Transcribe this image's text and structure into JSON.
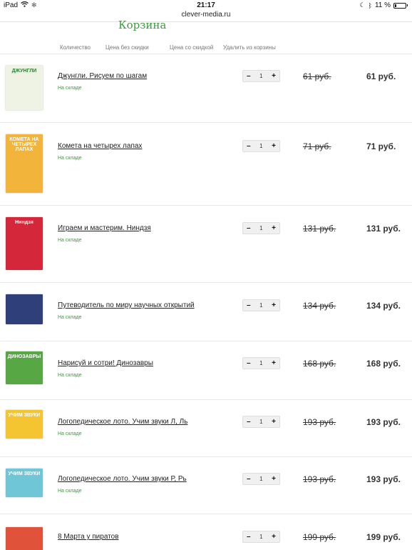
{
  "statusbar": {
    "device": "iPad",
    "time": "21:17",
    "battery": "11 %",
    "url": "clever-media.ru"
  },
  "page": {
    "title": "Корзина"
  },
  "columns": {
    "qty": "Количество",
    "price_no_discount": "Цена без скидки",
    "price_discount": "Цена со скидкой",
    "remove": "Удалить из корзины"
  },
  "colors": {
    "accent_green": "#3f9a3f",
    "stock_green": "#3c9a3c"
  },
  "items": [
    {
      "name": "Джунгли. Рисуем по шагам",
      "stock": "На складе",
      "qty": "1",
      "old_price": "61 руб.",
      "price": "61 руб.",
      "cover_text": "ДЖУНГЛИ",
      "cover_color": "#eef3e4"
    },
    {
      "name": "Комета на четырех лапах",
      "stock": "На складе",
      "qty": "1",
      "old_price": "71 руб.",
      "price": "71 руб.",
      "cover_text": "КОМЕТА НА ЧЕТЫРЕХ ЛАПАХ",
      "cover_color": "#f2b43a"
    },
    {
      "name": "Играем и мастерим. Ниндзя",
      "stock": "На складе",
      "qty": "1",
      "old_price": "131 руб.",
      "price": "131 руб.",
      "cover_text": "Ниндзя",
      "cover_color": "#d4283a"
    },
    {
      "name": "Путеводитель по миру научных открытий",
      "stock": "На складе",
      "qty": "1",
      "old_price": "134 руб.",
      "price": "134 руб.",
      "cover_text": "",
      "cover_color": "#2f3f7a"
    },
    {
      "name": "Нарисуй и сотри! Динозавры",
      "stock": "На складе",
      "qty": "1",
      "old_price": "168 руб.",
      "price": "168 руб.",
      "cover_text": "ДИНОЗАВРЫ",
      "cover_color": "#57a844"
    },
    {
      "name": "Логопедическое лото. Учим звуки Л, Ль",
      "stock": "На складе",
      "qty": "1",
      "old_price": "193 руб.",
      "price": "193 руб.",
      "cover_text": "УЧИМ ЗВУКИ",
      "cover_color": "#f4c531"
    },
    {
      "name": "Логопедическое лото. Учим звуки Р, Рь",
      "stock": "На складе",
      "qty": "1",
      "old_price": "193 руб.",
      "price": "193 руб.",
      "cover_text": "УЧИМ ЗВУКИ",
      "cover_color": "#6fc6d6"
    },
    {
      "name": "8 Марта у пиратов",
      "stock": "",
      "qty": "1",
      "old_price": "199 руб.",
      "price": "199 руб.",
      "cover_text": "",
      "cover_color": "#e0533a"
    }
  ]
}
